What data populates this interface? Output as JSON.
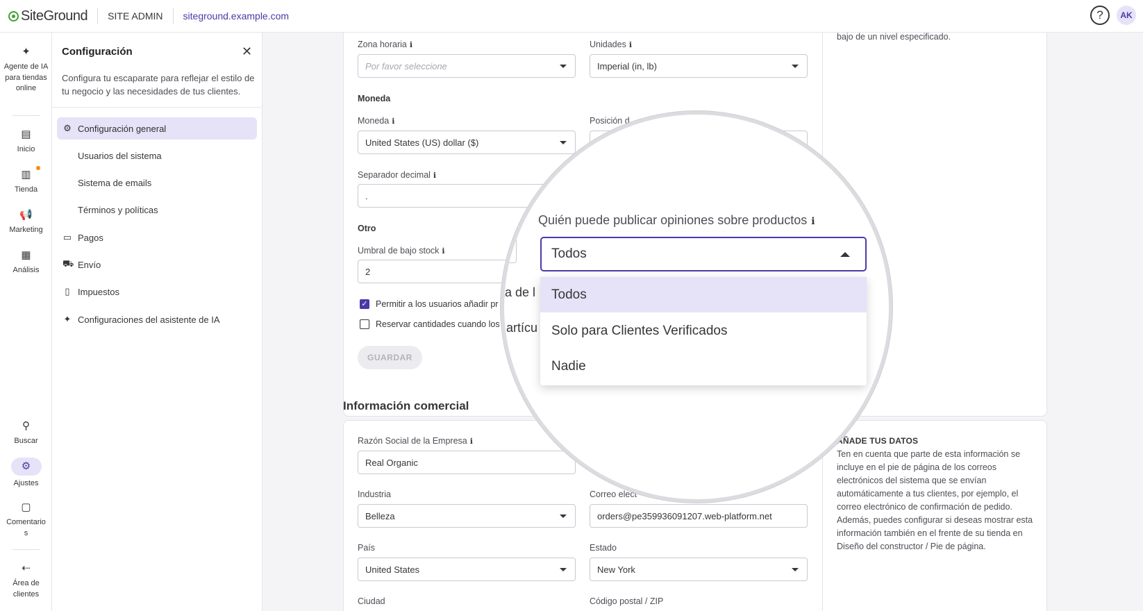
{
  "topbar": {
    "logo": "SiteGround",
    "site_admin": "SITE ADMIN",
    "domain": "siteground.example.com",
    "help": "?",
    "avatar": "AK"
  },
  "leftnav": [
    {
      "label": "Agente de IA para tiendas online",
      "icon": "sparkle-icon"
    },
    {
      "label": "Inicio",
      "icon": "home-icon"
    },
    {
      "label": "Tienda",
      "icon": "store-icon"
    },
    {
      "label": "Marketing",
      "icon": "megaphone-icon"
    },
    {
      "label": "Análisis",
      "icon": "chart-icon"
    },
    {
      "label": "Buscar",
      "icon": "search-icon"
    },
    {
      "label": "Ajustes",
      "icon": "gear-icon"
    },
    {
      "label": "Comentarios",
      "icon": "comment-icon"
    },
    {
      "label": "Área de clientes",
      "icon": "logout-icon"
    }
  ],
  "settings_panel": {
    "title": "Configuración",
    "description": "Configura tu escaparate para reflejar el estilo de tu negocio y las necesidades de tus clientes.",
    "items": [
      {
        "label": "Configuración general",
        "icon": "gear-icon",
        "active": true
      },
      {
        "label": "Usuarios del sistema"
      },
      {
        "label": "Sistema de emails"
      },
      {
        "label": "Términos y políticas"
      },
      {
        "label": "Pagos",
        "icon": "card-icon"
      },
      {
        "label": "Envío",
        "icon": "truck-icon"
      },
      {
        "label": "Impuestos",
        "icon": "document-icon"
      },
      {
        "label": "Configuraciones del asistente de IA",
        "icon": "sparkle-icon"
      }
    ]
  },
  "general": {
    "zona_horaria": {
      "label": "Zona horaria",
      "placeholder": "Por favor seleccione"
    },
    "unidades": {
      "label": "Unidades",
      "value": "Imperial (in, lb)"
    },
    "moneda_heading": "Moneda",
    "moneda": {
      "label": "Moneda",
      "value": "United States (US) dollar ($)"
    },
    "posicion_label": "Posición d",
    "separador": {
      "label": "Separador decimal",
      "value": "."
    },
    "otro_heading": "Otro",
    "umbral": {
      "label": "Umbral de bajo stock",
      "value": "2"
    },
    "check1": "Permitir a los usuarios añadir pr",
    "check2": "Reservar cantidades cuando los",
    "save": "GUARDAR",
    "side_text": "bajo de un nivel especificado."
  },
  "business": {
    "section_title": "Información comercial",
    "razon": {
      "label": "Razón Social de la Empresa",
      "value": "Real Organic"
    },
    "industria": {
      "label": "Industria",
      "value": "Belleza"
    },
    "correo": {
      "label": "Correo elect",
      "value": "orders@pe359936091207.web-platform.net"
    },
    "pais": {
      "label": "País",
      "value": "United States"
    },
    "estado": {
      "label": "Estado",
      "value": "New York"
    },
    "ciudad_label": "Ciudad",
    "codigo_label": "Código postal / ZIP",
    "side_head": "AÑADE TUS DATOS",
    "side_text": "Ten en cuenta que parte de esta información se incluye en el pie de página de los correos electrónicos del sistema que se envían automáticamente a tus clientes, por ejemplo, el correo electrónico de confirmación de pedido. Además, puedes configurar si deseas mostrar esta información también en el frente de su tienda en Diseño del constructor / Pie de página."
  },
  "magnifier": {
    "label": "Quién puede publicar opiniones sobre productos",
    "value": "Todos",
    "options": [
      "Todos",
      "Solo para Clientes Verificados",
      "Nadie"
    ],
    "bg_text1": "ta de l",
    "bg_text2": "artícu"
  }
}
